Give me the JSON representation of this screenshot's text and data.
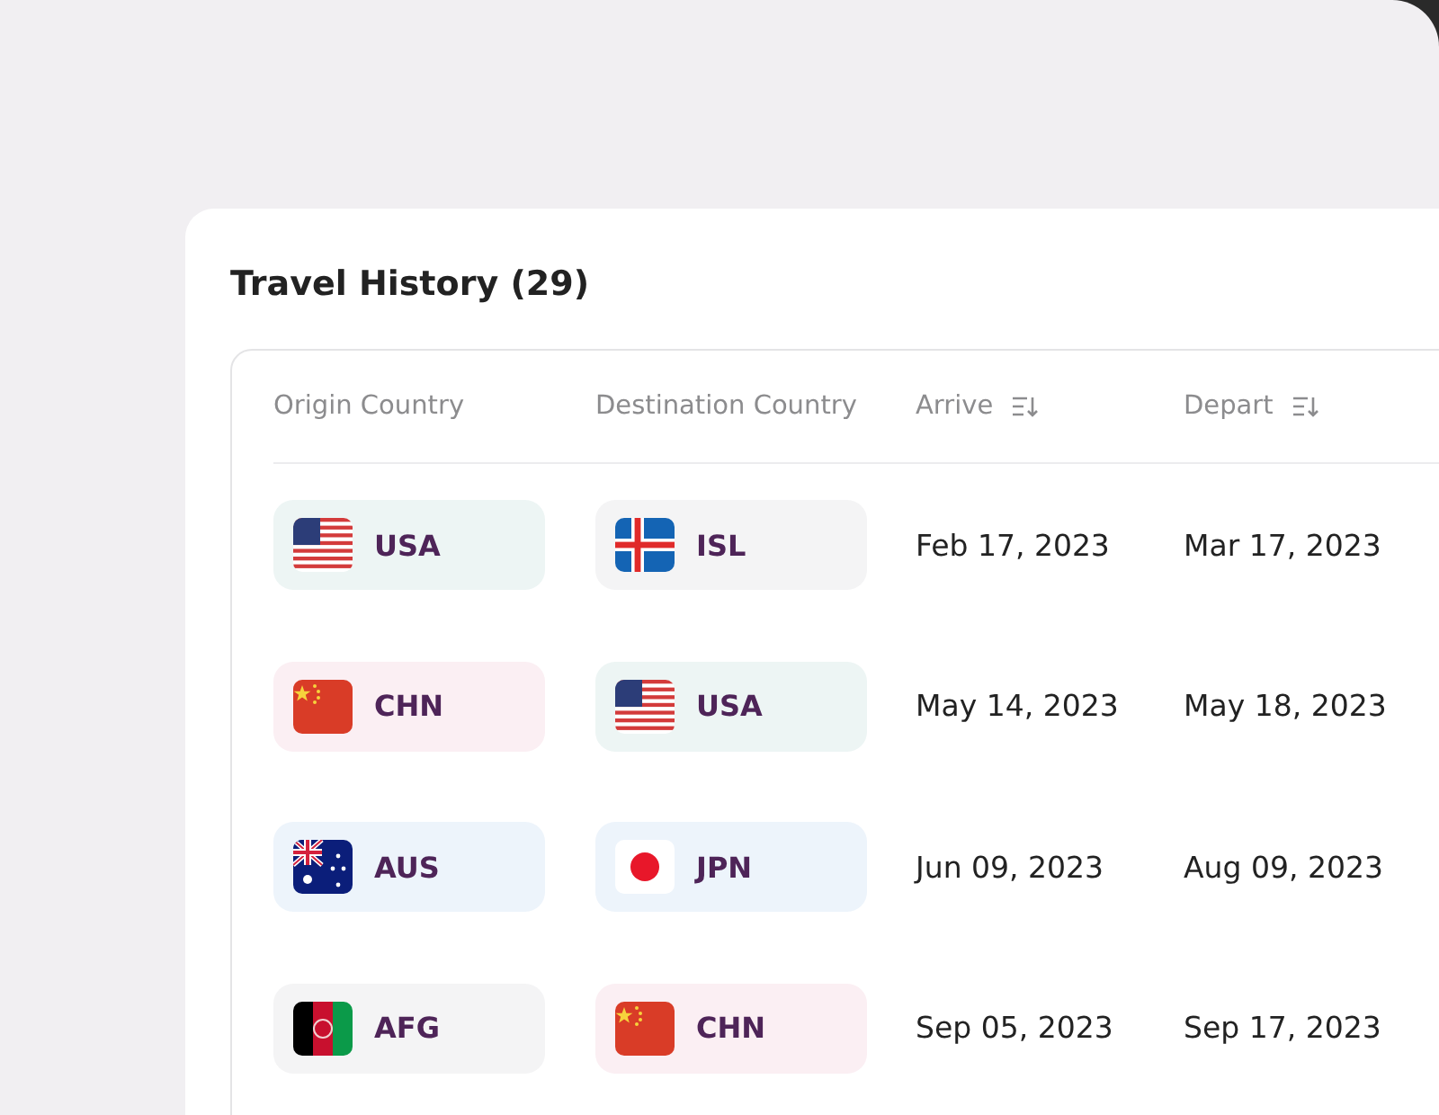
{
  "card": {
    "title": "Travel History (29)"
  },
  "table": {
    "columns": [
      {
        "label": "Origin Country",
        "sortable": false
      },
      {
        "label": "Destination Country",
        "sortable": false
      },
      {
        "label": "Arrive",
        "sortable": true
      },
      {
        "label": "Depart",
        "sortable": true
      }
    ],
    "rows": [
      {
        "origin": {
          "code": "USA",
          "kind": "us",
          "color": "#edf5f4"
        },
        "destination": {
          "code": "ISL",
          "kind": "is",
          "color": "#f4f4f5"
        },
        "arrive": "Feb 17, 2023",
        "depart": "Mar 17, 2023"
      },
      {
        "origin": {
          "code": "CHN",
          "kind": "cn",
          "color": "#fbeff3"
        },
        "destination": {
          "code": "USA",
          "kind": "us",
          "color": "#edf5f4"
        },
        "arrive": "May 14, 2023",
        "depart": "May 18, 2023"
      },
      {
        "origin": {
          "code": "AUS",
          "kind": "au",
          "color": "#edf4fb"
        },
        "destination": {
          "code": "JPN",
          "kind": "jp",
          "color": "#edf4fb"
        },
        "arrive": "Jun 09, 2023",
        "depart": "Aug 09, 2023"
      },
      {
        "origin": {
          "code": "AFG",
          "kind": "af",
          "color": "#f4f4f5"
        },
        "destination": {
          "code": "CHN",
          "kind": "cn",
          "color": "#fbeff3"
        },
        "arrive": "Sep 05, 2023",
        "depart": "Sep 17, 2023"
      }
    ]
  }
}
